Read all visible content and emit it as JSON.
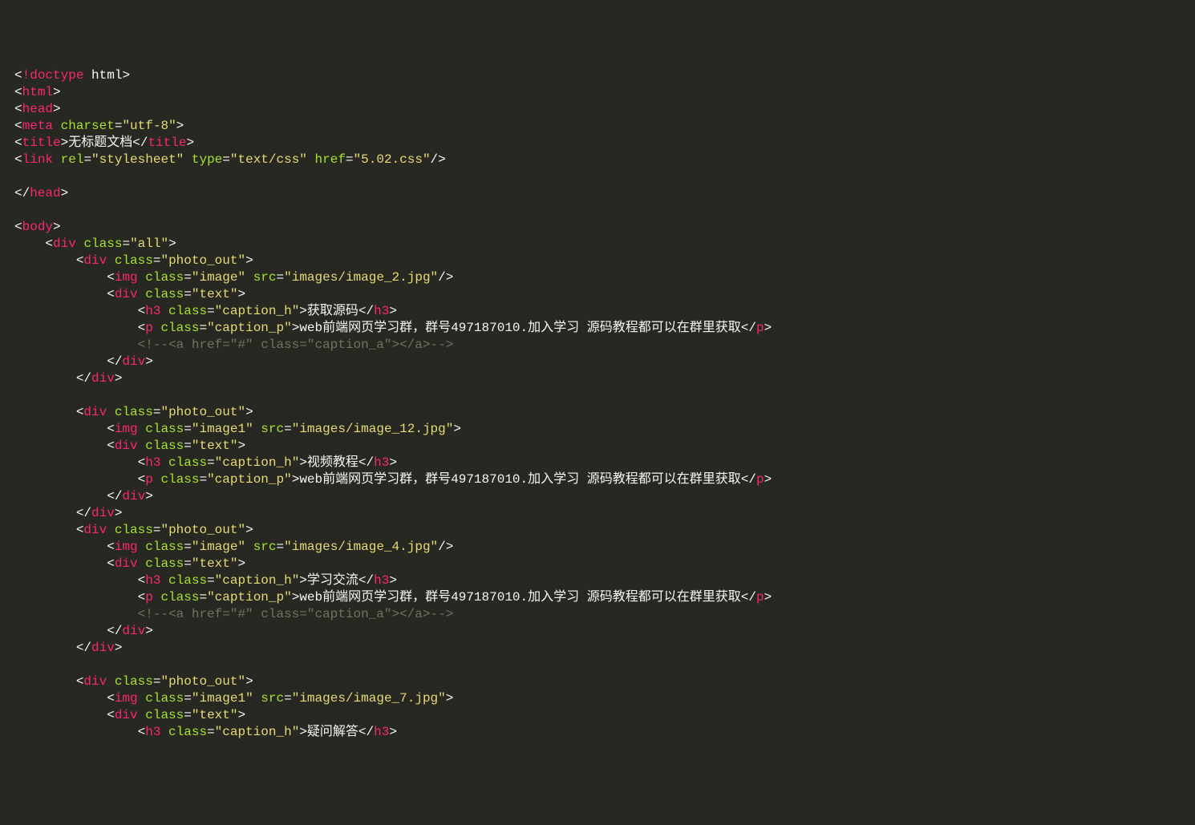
{
  "doctype": {
    "kw": "!doctype",
    "val": "html"
  },
  "head": {
    "tag_html": "html",
    "tag_head": "head",
    "meta": {
      "tag": "meta",
      "attr_charset": "charset",
      "val_charset": "\"utf-8\""
    },
    "title": {
      "tag": "title",
      "content": "无标题文档"
    },
    "link": {
      "tag": "link",
      "attr_rel": "rel",
      "val_rel": "\"stylesheet\"",
      "attr_type": "type",
      "val_type": "\"text/css\"",
      "attr_href": "href",
      "val_href": "\"5.02.css\""
    }
  },
  "body": {
    "tag_body": "body",
    "div_all": {
      "tag": "div",
      "attr_class": "class",
      "val_class": "\"all\""
    },
    "photo_out": {
      "tag": "div",
      "attr_class": "class",
      "val_class": "\"photo_out\""
    },
    "img_image": {
      "tag": "img",
      "attr_class": "class",
      "val_class_image": "\"image\"",
      "val_class_image1": "\"image1\"",
      "attr_src": "src",
      "src2": "\"images/image_2.jpg\"",
      "src12": "\"images/image_12.jpg\"",
      "src4": "\"images/image_4.jpg\"",
      "src7": "\"images/image_7.jpg\""
    },
    "div_text": {
      "tag": "div",
      "attr_class": "class",
      "val_class": "\"text\""
    },
    "h3": {
      "tag": "h3",
      "attr_class": "class",
      "val_class": "\"caption_h\"",
      "t1": "获取源码",
      "t2": "视频教程",
      "t3": "学习交流",
      "t4": "疑问解答"
    },
    "p": {
      "tag": "p",
      "attr_class": "class",
      "val_class": "\"caption_p\"",
      "content": "web前端网页学习群，群号497187010.加入学习 源码教程都可以在群里获取"
    },
    "comment_a": "<!--<a href=\"#\" class=\"caption_a\"></a>-->"
  }
}
